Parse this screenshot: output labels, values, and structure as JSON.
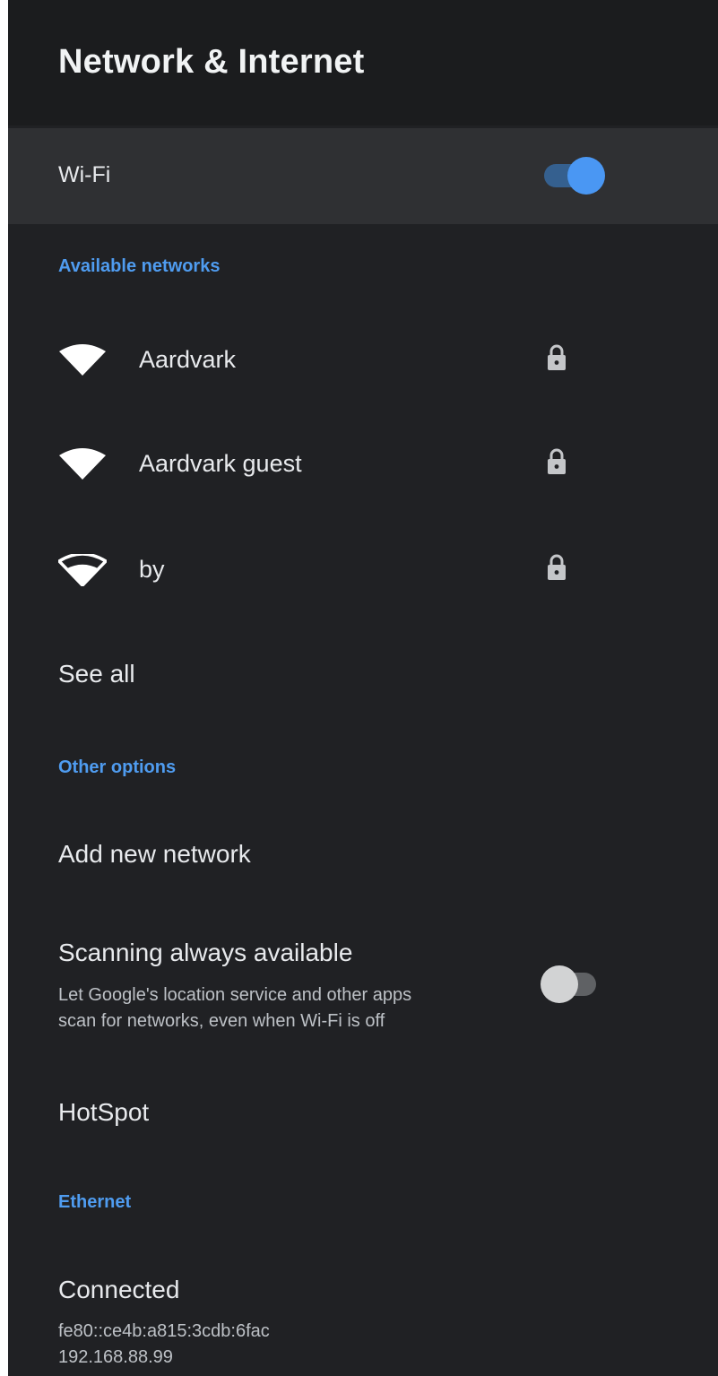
{
  "header": {
    "title": "Network & Internet"
  },
  "wifi": {
    "label": "Wi-Fi",
    "enabled": true,
    "toggle_color": "#4a97f3"
  },
  "available": {
    "section_label": "Available networks",
    "networks": [
      {
        "name": "Aardvark",
        "icon": "wifi-signal-full-icon",
        "secured": true,
        "lock_icon": "lock-icon"
      },
      {
        "name": "Aardvark guest",
        "icon": "wifi-signal-full-icon",
        "secured": true,
        "lock_icon": "lock-icon"
      },
      {
        "name": "by",
        "icon": "wifi-signal-medium-icon",
        "secured": true,
        "lock_icon": "lock-icon"
      }
    ],
    "see_all_label": "See all"
  },
  "other_options": {
    "section_label": "Other options",
    "add_network_label": "Add new network",
    "scanning": {
      "title": "Scanning always available",
      "description_line1": "Let Google's location service and other apps",
      "description_line2": "scan for networks, even when Wi-Fi is off",
      "enabled": false
    },
    "hotspot_label": "HotSpot"
  },
  "ethernet": {
    "section_label": "Ethernet",
    "status": "Connected",
    "ipv6": "fe80::ce4b:a815:3cdb:6fac",
    "ipv4": "192.168.88.99"
  },
  "colors": {
    "background": "#202124",
    "accent": "#4f9cf0",
    "wifi_row_highlight": "#2f3033"
  }
}
